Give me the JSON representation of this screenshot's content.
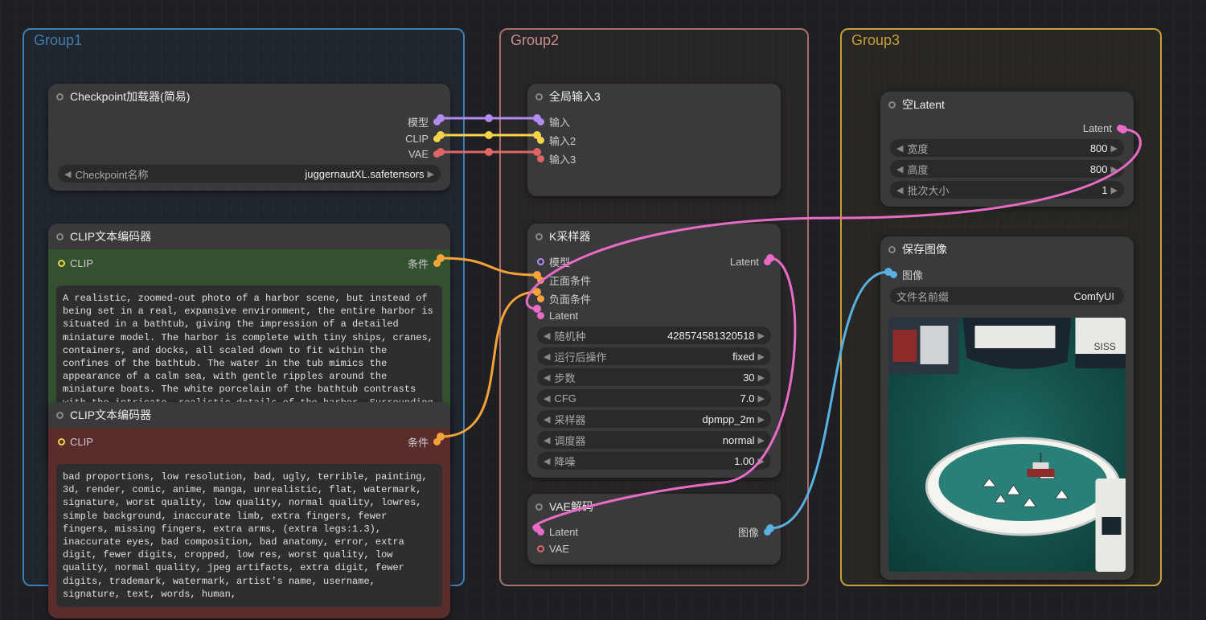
{
  "groups": {
    "g1": {
      "title": "Group1",
      "color": "#3d7fb5"
    },
    "g2": {
      "title": "Group2",
      "color": "#a86d6d"
    },
    "g3": {
      "title": "Group3",
      "color": "#c6a13a"
    }
  },
  "checkpoint": {
    "title": "Checkpoint加载器(简易)",
    "outputs": {
      "model": "模型",
      "clip": "CLIP",
      "vae": "VAE"
    },
    "widget_label": "Checkpoint名称",
    "widget_value": "juggernautXL.safetensors"
  },
  "clip_pos": {
    "title": "CLIP文本编码器",
    "input": "CLIP",
    "output": "条件",
    "text": "A realistic, zoomed-out photo of a harbor scene, but instead of being set in a real, expansive environment, the entire harbor is situated in a bathtub, giving the impression of a detailed miniature model. The harbor is complete with tiny ships, cranes, containers, and docks, all scaled down to fit within the confines of the bathtub. The water in the tub mimics the appearance of a calm sea, with gentle ripples around the miniature boats. The white porcelain of the bathtub contrasts with the intricate, realistic details of the harbor. Surrounding the bathtub are everyday bathroom items, subtly visible in the background, reinforcing the surreal setting of this miniature world."
  },
  "clip_neg": {
    "title": "CLIP文本编码器",
    "input": "CLIP",
    "output": "条件",
    "text": "bad proportions, low resolution, bad, ugly, terrible, painting, 3d, render, comic, anime, manga, unrealistic, flat, watermark, signature, worst quality, low quality, normal quality, lowres, simple background, inaccurate limb, extra fingers, fewer fingers, missing fingers, extra arms, (extra legs:1.3), inaccurate eyes, bad composition, bad anatomy, error, extra digit, fewer digits, cropped, low res, worst quality, low quality, normal quality, jpeg artifacts, extra digit, fewer digits, trademark, watermark, artist's name, username, signature, text, words, human,"
  },
  "global_in": {
    "title": "全局输入3",
    "inputs": [
      "输入",
      "输入2",
      "输入3"
    ]
  },
  "sampler": {
    "title": "K采样器",
    "inputs": {
      "model": "模型",
      "positive": "正面条件",
      "negative": "负面条件",
      "latent": "Latent"
    },
    "output": "Latent",
    "widgets": [
      {
        "label": "随机种",
        "value": "428574581320518"
      },
      {
        "label": "运行后操作",
        "value": "fixed"
      },
      {
        "label": "步数",
        "value": "30"
      },
      {
        "label": "CFG",
        "value": "7.0"
      },
      {
        "label": "采样器",
        "value": "dpmpp_2m"
      },
      {
        "label": "调度器",
        "value": "normal"
      },
      {
        "label": "降噪",
        "value": "1.00"
      }
    ]
  },
  "vae_decode": {
    "title": "VAE解码",
    "inputs": {
      "latent": "Latent",
      "vae": "VAE"
    },
    "output": "图像"
  },
  "empty_latent": {
    "title": "空Latent",
    "output": "Latent",
    "widgets": [
      {
        "label": "宽度",
        "value": "800"
      },
      {
        "label": "高度",
        "value": "800"
      },
      {
        "label": "批次大小",
        "value": "1"
      }
    ]
  },
  "save_image": {
    "title": "保存图像",
    "input": "图像",
    "widget_label": "文件名前缀",
    "widget_value": "ComfyUI"
  },
  "colors": {
    "model": "#b18cf0",
    "clip": "#f3d34a",
    "vae": "#e06666",
    "cond": "#f4a33a",
    "latent": "#e86cc6",
    "image": "#5ab0e0"
  }
}
